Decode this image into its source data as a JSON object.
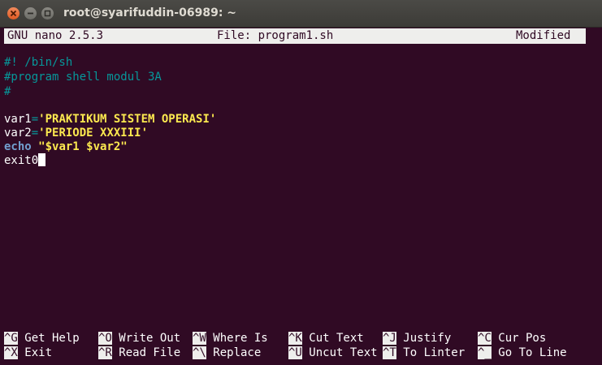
{
  "window": {
    "title": "root@syarifuddin-06989: ~"
  },
  "nano": {
    "version": "GNU nano 2.5.3",
    "file": "File: program1.sh",
    "status": "Modified"
  },
  "editor": {
    "line1": "#! /bin/sh",
    "line2": "#program shell modul 3A",
    "line3": "#",
    "line4": "",
    "line5": {
      "var": "var1",
      "eq": "=",
      "value": "'PRAKTIKUM SISTEM OPERASI'"
    },
    "line6": {
      "var": "var2",
      "eq": "=",
      "value": "'PERIODE XXXIII'"
    },
    "line7": {
      "keyword": "echo",
      "space": " ",
      "value": "\"$var1 $var2\""
    },
    "line8": "exit0"
  },
  "shortcuts": [
    {
      "key": "^G",
      "label": " Get Help"
    },
    {
      "key": "^O",
      "label": " Write Out"
    },
    {
      "key": "^W",
      "label": " Where Is"
    },
    {
      "key": "^K",
      "label": " Cut Text"
    },
    {
      "key": "^J",
      "label": " Justify"
    },
    {
      "key": "^C",
      "label": " Cur Pos"
    },
    {
      "key": "^X",
      "label": " Exit"
    },
    {
      "key": "^R",
      "label": " Read File"
    },
    {
      "key": "^\\",
      "label": " Replace"
    },
    {
      "key": "^U",
      "label": " Uncut Text"
    },
    {
      "key": "^T",
      "label": " To Linter"
    },
    {
      "key": "^_",
      "label": " Go To Line"
    }
  ],
  "icons": {
    "close": "close-icon",
    "minimize": "minimize-icon",
    "maximize": "maximize-icon"
  },
  "colors": {
    "background": "#300a24",
    "comment": "#06989a",
    "string": "#fce94f",
    "keyword": "#729fcf",
    "close_button": "#e25a23"
  }
}
